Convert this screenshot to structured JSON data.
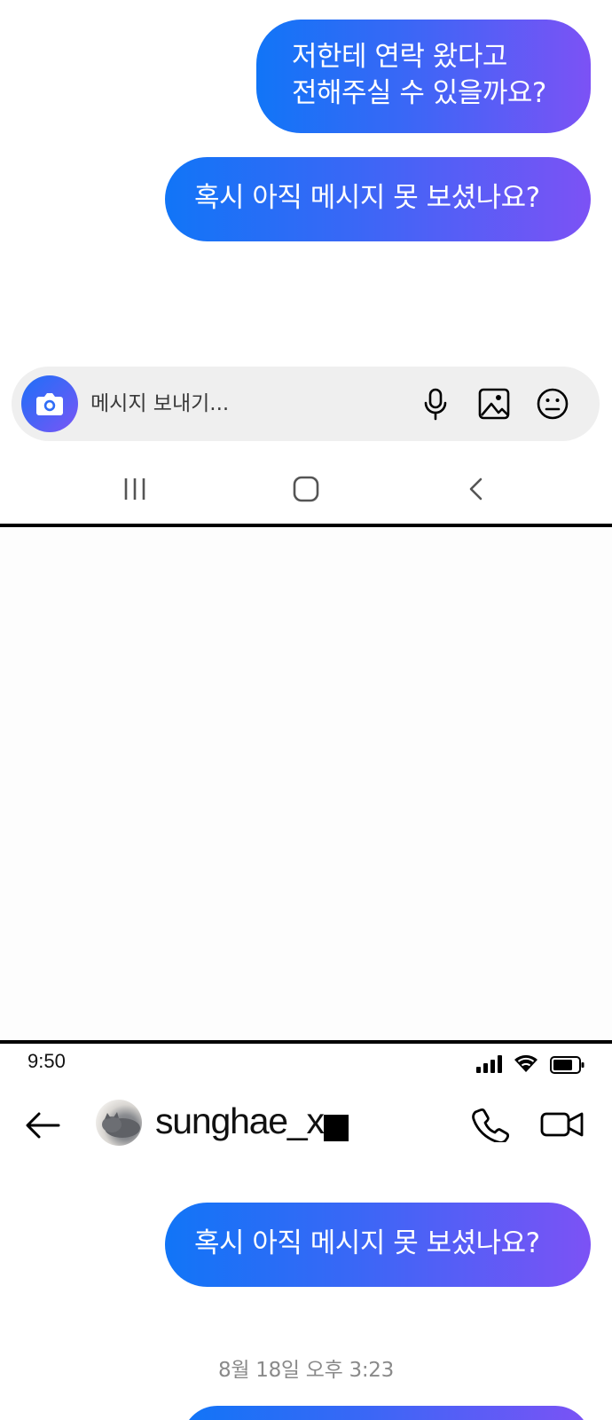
{
  "conversation_top": {
    "messages": [
      {
        "lines": [
          "저한테 연락 왔다고",
          "전해주실 수 있을까요?"
        ]
      },
      {
        "lines": [
          "혹시 아직 메시지 못 보셨나요?"
        ]
      }
    ]
  },
  "composer": {
    "placeholder": "메시지 보내기...",
    "camera_icon": "camera-icon",
    "mic_icon": "microphone-icon",
    "gallery_icon": "image-icon",
    "sticker_icon": "emoji-icon"
  },
  "system_nav": {
    "recents_icon": "recents-icon",
    "home_icon": "home-icon",
    "back_icon": "chevron-left-icon"
  },
  "status_bar": {
    "time": "9:50",
    "signal_icon": "signal-icon",
    "wifi_icon": "wifi-icon",
    "battery_icon": "battery-icon"
  },
  "header": {
    "back_icon": "arrow-left-icon",
    "username": "sunghae_x",
    "phone_icon": "phone-icon",
    "video_icon": "video-camera-icon"
  },
  "conversation_bottom": {
    "messages": [
      {
        "lines": [
          "혹시 아직 메시지 못 보셨나요?"
        ]
      }
    ],
    "timestamp": "8월 18일 오후 3:23"
  },
  "colors": {
    "bubble_gradient_start": "#1175f7",
    "bubble_gradient_end": "#7c52f5",
    "composer_bg": "#efefef",
    "timestamp_text": "#8a8a8a"
  }
}
